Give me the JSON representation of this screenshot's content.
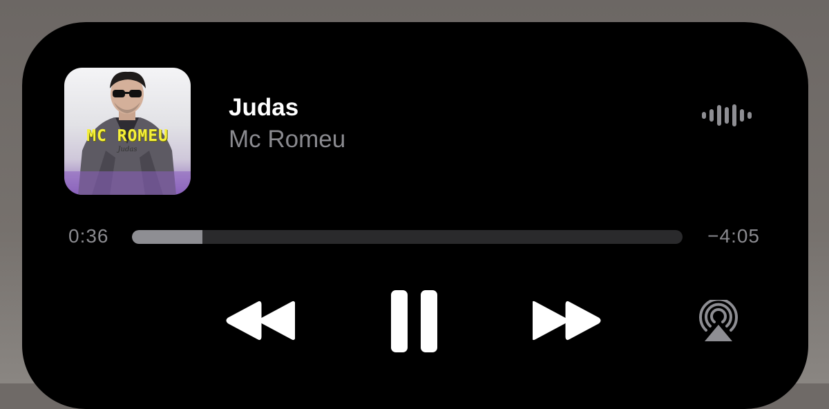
{
  "track": {
    "title": "Judas",
    "artist": "Mc Romeu",
    "artwork_title": "MC ROMEU",
    "artwork_subtitle": "Judas"
  },
  "playback": {
    "elapsed": "0:36",
    "remaining": "−4:05",
    "progress_fraction": 0.128,
    "state": "playing"
  },
  "icons": {
    "waveform": "waveform-icon",
    "rewind": "rewind-icon",
    "pause": "pause-icon",
    "forward": "fast-forward-icon",
    "airplay": "airplay-icon"
  },
  "colors": {
    "panel": "#000000",
    "primary_text": "#ffffff",
    "secondary_text": "#8a8a8f",
    "progress_fill": "#8e8e93",
    "progress_track": "#2a2a2c",
    "artwork_title": "#f6f03a"
  }
}
